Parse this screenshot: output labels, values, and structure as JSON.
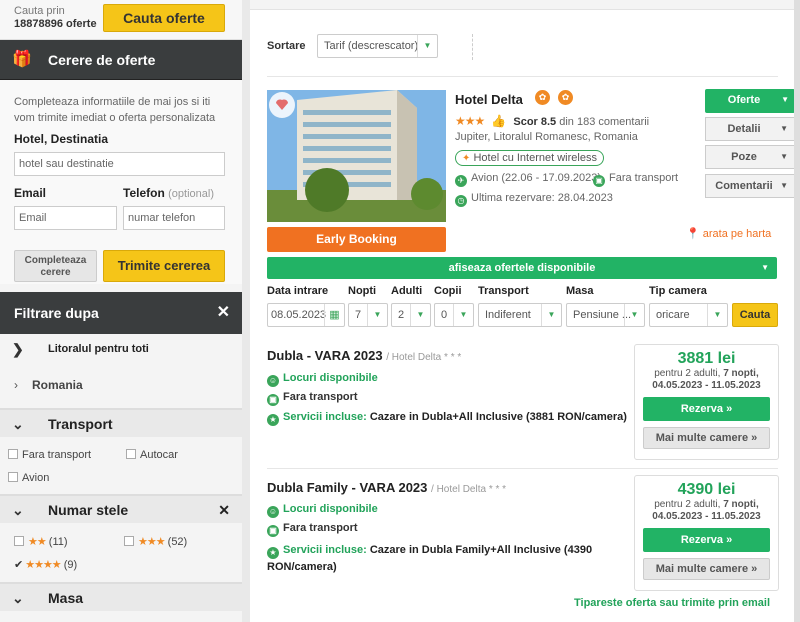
{
  "search_top": {
    "label": "Cauta prin",
    "count": "18878896 oferte",
    "button": "Cauta oferte"
  },
  "request": {
    "title": "Cerere de oferte",
    "intro": "Completeaza informatiile de mai jos si iti vom trimite imediat o oferta personalizata",
    "destination_label": "Hotel, Destinatia",
    "destination_placeholder": "hotel sau destinatie",
    "email_label": "Email",
    "email_placeholder": "Email",
    "phone_label": "Telefon",
    "phone_optional": "(optional)",
    "phone_placeholder": "numar telefon",
    "complete_button": "Completeaza cerere",
    "send_button": "Trimite cererea"
  },
  "filters": {
    "title": "Filtrare dupa",
    "section1": "Litoralul pentru toti",
    "country": "Romania",
    "transport": {
      "title": "Transport",
      "options": [
        "Fara transport",
        "Autocar",
        "Avion"
      ]
    },
    "stars": {
      "title": "Numar stele",
      "options": [
        {
          "stars": "★★",
          "count": "(11)"
        },
        {
          "stars": "★★★",
          "count": "(52)"
        },
        {
          "stars": "★★★★",
          "count": "(9)"
        }
      ]
    },
    "meal": {
      "title": "Masa"
    }
  },
  "sort": {
    "label": "Sortare",
    "value": "Tarif (descrescator)"
  },
  "hotel": {
    "name": "Hotel Delta",
    "stars": "★★★",
    "score": "Scor 8.5",
    "reviews": "din 183 comentarii",
    "location": "Jupiter, Litoralul Romanesc, Romania",
    "wifi": "Hotel cu Internet wireless",
    "flight": "Avion (22.06 - 17.09.2023)",
    "no_transport": "Fara transport",
    "last_booking": "Ultima rezervare: 28.04.2023",
    "early_booking": "Early Booking",
    "map_link": "arata pe harta",
    "buttons": {
      "offers": "Oferte",
      "details": "Detalii",
      "photos": "Poze",
      "comments": "Comentarii"
    },
    "show_offers": "afiseaza ofertele disponibile"
  },
  "booking_form": {
    "checkin_label": "Data intrare",
    "checkin": "08.05.2023",
    "nights_label": "Nopti",
    "nights": "7",
    "adults_label": "Adulti",
    "adults": "2",
    "children_label": "Copii",
    "children": "0",
    "transport_label": "Transport",
    "transport": "Indiferent",
    "meal_label": "Masa",
    "meal": "Pensiune ...",
    "room_label": "Tip camera",
    "room": "oricare",
    "search_button": "Cauta"
  },
  "offers": [
    {
      "title": "Dubla - VARA 2023",
      "hotel": "/ Hotel Delta * * *",
      "availability": "Locuri disponibile",
      "transport": "Fara transport",
      "services_label": "Servicii incluse:",
      "services": "Cazare in Dubla+All Inclusive (3881 RON/camera)",
      "price": "3881 lei",
      "price_desc_1": "pentru 2 adulti,",
      "price_desc_nights": "7 nopti,",
      "price_desc_2": "04.05.2023 - 11.05.2023",
      "book_button": "Rezerva »",
      "more_rooms": "Mai multe camere »"
    },
    {
      "title": "Dubla Family - VARA 2023",
      "hotel": "/ Hotel Delta * * *",
      "availability": "Locuri disponibile",
      "transport": "Fara transport",
      "services_label": "Servicii incluse:",
      "services": "Cazare in Dubla Family+All Inclusive (4390 RON/camera)",
      "price": "4390 lei",
      "price_desc_1": "pentru 2 adulti,",
      "price_desc_nights": "7 nopti,",
      "price_desc_2": "04.05.2023 - 11.05.2023",
      "book_button": "Rezerva »",
      "more_rooms": "Mai multe camere »"
    }
  ],
  "print_link": "Tipareste oferta sau trimite prin email",
  "colors": {
    "green": "#22b365",
    "orange": "#f07121",
    "yellow": "#f5c518",
    "dark": "#3a3d3e"
  }
}
